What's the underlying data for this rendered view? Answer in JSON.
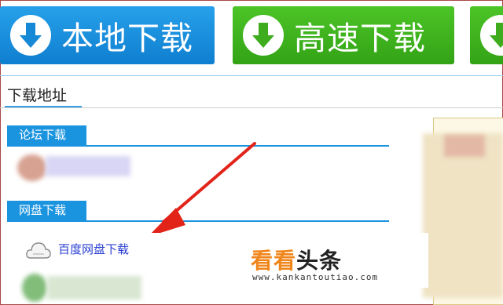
{
  "buttons": {
    "local_label": "本地下载",
    "fast_label": "高速下载"
  },
  "download_title": "下载地址",
  "sections": {
    "forum_label": "论坛下载",
    "netdisk_label": "网盘下载"
  },
  "links": {
    "baidu": "百度网盘下载"
  },
  "watermark": {
    "brand_orange": "看看",
    "brand_dark": "头条",
    "url": "www.kankantoutiao.com"
  },
  "colors": {
    "blue": "#1b94e0",
    "green": "#3fb420",
    "arrow_red": "#e2231a",
    "link_blue": "#2a3fd1"
  }
}
